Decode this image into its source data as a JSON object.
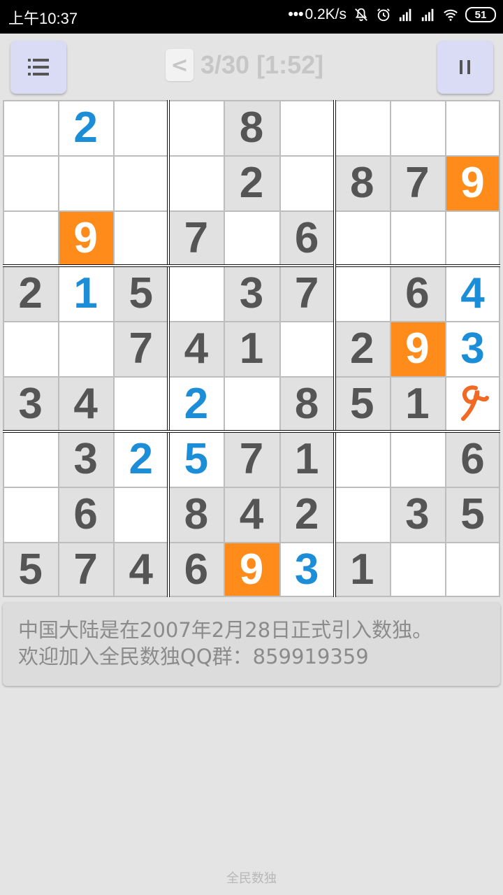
{
  "status_bar": {
    "time": "上午10:37",
    "network_speed": "0.2K/s",
    "battery": "51"
  },
  "toolbar": {
    "menu_icon": "hamburger-icon",
    "back_label": "<",
    "title": "3/30 [1:52]",
    "pause_icon": "pause-icon"
  },
  "puzzle": {
    "rows": [
      [
        null,
        {
          "v": "2",
          "t": "user"
        },
        null,
        null,
        {
          "v": "8",
          "t": "given"
        },
        null,
        null,
        null,
        null
      ],
      [
        null,
        null,
        null,
        null,
        {
          "v": "2",
          "t": "given"
        },
        null,
        {
          "v": "8",
          "t": "given"
        },
        {
          "v": "7",
          "t": "given"
        },
        {
          "v": "9",
          "t": "hl"
        }
      ],
      [
        null,
        {
          "v": "9",
          "t": "hl"
        },
        null,
        {
          "v": "7",
          "t": "given"
        },
        null,
        {
          "v": "6",
          "t": "given"
        },
        null,
        null,
        null
      ],
      [
        {
          "v": "2",
          "t": "given"
        },
        {
          "v": "1",
          "t": "user"
        },
        {
          "v": "5",
          "t": "given"
        },
        null,
        {
          "v": "3",
          "t": "given"
        },
        {
          "v": "7",
          "t": "given"
        },
        null,
        {
          "v": "6",
          "t": "given"
        },
        {
          "v": "4",
          "t": "user"
        }
      ],
      [
        null,
        null,
        {
          "v": "7",
          "t": "given"
        },
        {
          "v": "4",
          "t": "given"
        },
        {
          "v": "1",
          "t": "given"
        },
        null,
        {
          "v": "2",
          "t": "given"
        },
        {
          "v": "9",
          "t": "hl"
        },
        {
          "v": "3",
          "t": "user"
        }
      ],
      [
        {
          "v": "3",
          "t": "given"
        },
        {
          "v": "4",
          "t": "given"
        },
        null,
        {
          "v": "2",
          "t": "user"
        },
        null,
        {
          "v": "8",
          "t": "given"
        },
        {
          "v": "5",
          "t": "given"
        },
        {
          "v": "1",
          "t": "given"
        },
        {
          "v": "",
          "t": "scribble"
        }
      ],
      [
        null,
        {
          "v": "3",
          "t": "given"
        },
        {
          "v": "2",
          "t": "user"
        },
        {
          "v": "5",
          "t": "user"
        },
        {
          "v": "7",
          "t": "given"
        },
        {
          "v": "1",
          "t": "given"
        },
        null,
        null,
        {
          "v": "6",
          "t": "given"
        }
      ],
      [
        null,
        {
          "v": "6",
          "t": "given"
        },
        null,
        {
          "v": "8",
          "t": "given"
        },
        {
          "v": "4",
          "t": "given"
        },
        {
          "v": "2",
          "t": "given"
        },
        null,
        {
          "v": "3",
          "t": "given"
        },
        {
          "v": "5",
          "t": "given"
        }
      ],
      [
        {
          "v": "5",
          "t": "given"
        },
        {
          "v": "7",
          "t": "given"
        },
        {
          "v": "4",
          "t": "given"
        },
        {
          "v": "6",
          "t": "given"
        },
        {
          "v": "9",
          "t": "hl"
        },
        {
          "v": "3",
          "t": "user"
        },
        {
          "v": "1",
          "t": "given"
        },
        null,
        null
      ]
    ]
  },
  "colors": {
    "given_bg": "#e1e1e1",
    "given_text": "#555555",
    "user_text": "#1c8ed8",
    "highlight_bg": "#ff8c1a",
    "scribble": "#f06a24"
  },
  "info": {
    "line1": "中国大陆是在2007年2月28日正式引入数独。",
    "line2": "欢迎加入全民数独QQ群：859919359"
  },
  "footer": "全民数独"
}
